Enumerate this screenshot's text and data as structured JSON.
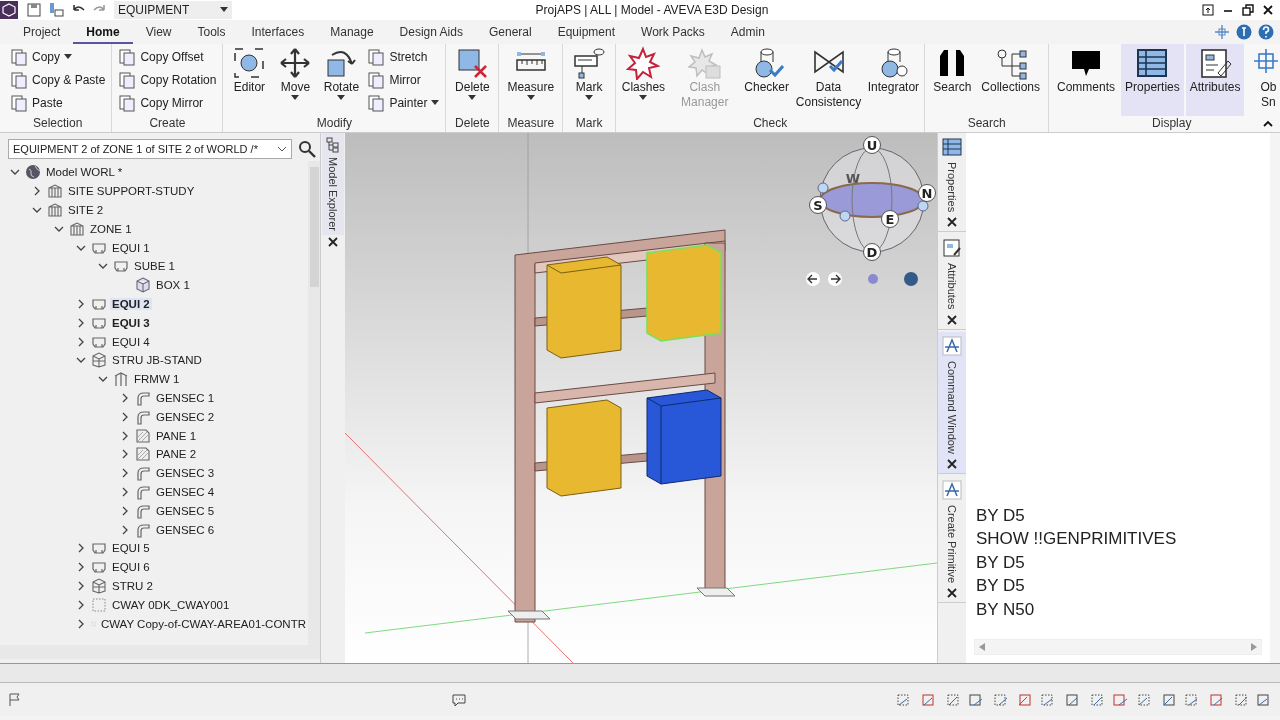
{
  "quick_access": {
    "combo_value": "EQUIPMENT"
  },
  "window": {
    "title": "ProjAPS | ALL | Model - AVEVA E3D Design"
  },
  "ribbon_tabs": [
    {
      "label": "Project",
      "selected": false
    },
    {
      "label": "Home",
      "selected": true
    },
    {
      "label": "View",
      "selected": false
    },
    {
      "label": "Tools",
      "selected": false
    },
    {
      "label": "Interfaces",
      "selected": false
    },
    {
      "label": "Manage",
      "selected": false
    },
    {
      "label": "Design Aids",
      "selected": false
    },
    {
      "label": "General",
      "selected": false
    },
    {
      "label": "Equipment",
      "selected": false
    },
    {
      "label": "Work Packs",
      "selected": false
    },
    {
      "label": "Admin",
      "selected": false
    }
  ],
  "ribbon_groups": [
    {
      "label": "Selection",
      "items": [
        {
          "kind": "small",
          "label": "Copy",
          "dropdown": true
        },
        {
          "kind": "small",
          "label": "Copy & Paste"
        },
        {
          "kind": "small",
          "label": "Paste"
        }
      ]
    },
    {
      "label": "Create",
      "items": [
        {
          "kind": "small",
          "label": "Copy Offset"
        },
        {
          "kind": "small",
          "label": "Copy Rotation"
        },
        {
          "kind": "small",
          "label": "Copy Mirror"
        }
      ]
    },
    {
      "label": "Modify",
      "items": [
        {
          "kind": "large",
          "label": "Editor"
        },
        {
          "kind": "large",
          "label": "Move",
          "dropdown": true
        },
        {
          "kind": "large",
          "label": "Rotate",
          "dropdown": true
        },
        {
          "kind": "small",
          "label": "Stretch"
        },
        {
          "kind": "small",
          "label": "Mirror"
        },
        {
          "kind": "small",
          "label": "Painter",
          "dropdown": true
        }
      ]
    },
    {
      "label": "Delete",
      "items": [
        {
          "kind": "large",
          "label": "Delete",
          "dropdown": true
        }
      ]
    },
    {
      "label": "Measure",
      "items": [
        {
          "kind": "large",
          "label": "Measure",
          "dropdown": true
        }
      ]
    },
    {
      "label": "Mark",
      "items": [
        {
          "kind": "large",
          "label": "Mark",
          "dropdown": true
        }
      ]
    },
    {
      "label": "Check",
      "items": [
        {
          "kind": "large",
          "label": "Clashes",
          "dropdown": true
        },
        {
          "kind": "large",
          "label": "Clash Manager",
          "disabled": true
        },
        {
          "kind": "large",
          "label": "Checker"
        },
        {
          "kind": "large",
          "label": "Data Consistency"
        },
        {
          "kind": "large",
          "label": "Integrator"
        }
      ]
    },
    {
      "label": "Search",
      "items": [
        {
          "kind": "large",
          "label": "Search"
        },
        {
          "kind": "large",
          "label": "Collections"
        }
      ]
    },
    {
      "label": "Display",
      "items": [
        {
          "kind": "large",
          "label": "Comments"
        },
        {
          "kind": "large",
          "label": "Properties",
          "on": true
        },
        {
          "kind": "large",
          "label": "Attributes",
          "on": true
        },
        {
          "kind": "large",
          "label": "Ob Sn"
        }
      ]
    }
  ],
  "explorer": {
    "path": "EQUIPMENT 2 of ZONE 1 of SITE 2 of WORLD /*",
    "side_tab": "Model Explorer",
    "tree": [
      {
        "label": "Model WORL *",
        "kind": "world",
        "expanded": true,
        "children": [
          {
            "label": "SITE SUPPORT-STUDY",
            "kind": "site",
            "expanded": false
          },
          {
            "label": "SITE 2",
            "kind": "site",
            "expanded": true,
            "children": [
              {
                "label": "ZONE 1",
                "kind": "site",
                "expanded": true,
                "children": [
                  {
                    "label": "EQUI 1",
                    "kind": "equi",
                    "expanded": true,
                    "children": [
                      {
                        "label": "SUBE 1",
                        "kind": "equi",
                        "expanded": true,
                        "children": [
                          {
                            "label": "BOX 1",
                            "kind": "box"
                          }
                        ]
                      }
                    ]
                  },
                  {
                    "label": "EQUI 2",
                    "kind": "equi",
                    "expanded": false,
                    "bold": true,
                    "selected": true
                  },
                  {
                    "label": "EQUI 3",
                    "kind": "equi",
                    "expanded": false,
                    "bold": true
                  },
                  {
                    "label": "EQUI 4",
                    "kind": "equi",
                    "expanded": false
                  },
                  {
                    "label": "STRU JB-STAND",
                    "kind": "stru",
                    "expanded": true,
                    "children": [
                      {
                        "label": "FRMW 1",
                        "kind": "frmw",
                        "expanded": true,
                        "children": [
                          {
                            "label": "GENSEC 1",
                            "kind": "gensec",
                            "expanded": false
                          },
                          {
                            "label": "GENSEC 2",
                            "kind": "gensec",
                            "expanded": false
                          },
                          {
                            "label": "PANE 1",
                            "kind": "pane",
                            "expanded": false
                          },
                          {
                            "label": "PANE 2",
                            "kind": "pane",
                            "expanded": false
                          },
                          {
                            "label": "GENSEC 3",
                            "kind": "gensec",
                            "expanded": false
                          },
                          {
                            "label": "GENSEC 4",
                            "kind": "gensec",
                            "expanded": false
                          },
                          {
                            "label": "GENSEC 5",
                            "kind": "gensec",
                            "expanded": false
                          },
                          {
                            "label": "GENSEC 6",
                            "kind": "gensec",
                            "expanded": false
                          }
                        ]
                      }
                    ]
                  },
                  {
                    "label": "EQUI 5",
                    "kind": "equi",
                    "expanded": false
                  },
                  {
                    "label": "EQUI 6",
                    "kind": "equi",
                    "expanded": false
                  },
                  {
                    "label": "STRU 2",
                    "kind": "stru",
                    "expanded": false
                  },
                  {
                    "label": "CWAY 0DK_CWAY001",
                    "kind": "cway",
                    "expanded": false
                  },
                  {
                    "label": "CWAY Copy-of-CWAY-AREA01-CONTR",
                    "kind": "cway",
                    "expanded": false
                  }
                ]
              }
            ]
          }
        ]
      }
    ]
  },
  "view_cube": {
    "labels": [
      "U",
      "N",
      "S",
      "E",
      "D",
      "W"
    ]
  },
  "side_tabs": [
    {
      "label": "Properties",
      "selected": false
    },
    {
      "label": "Attributes",
      "selected": false
    },
    {
      "label": "Command Window",
      "selected": true
    },
    {
      "label": "Create Primitive",
      "selected": false
    }
  ],
  "command_window": {
    "lines": [
      "BY D5",
      "SHOW !!GENPRIMITIVES",
      "BY D5",
      "BY D5",
      "BY N50"
    ]
  }
}
